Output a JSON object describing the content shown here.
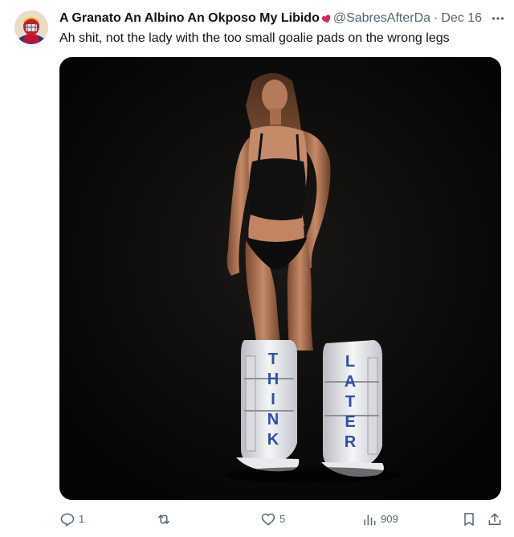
{
  "author": {
    "display_name": "A Granato An Albino An Okposo My Libido",
    "name_emoji": "heart-emoji",
    "handle": "@SabresAfterDa",
    "separator": "·",
    "date": "Dec 16",
    "avatar_icon": "avatar-goalie-helmet"
  },
  "tweet": {
    "text": "Ah shit, not the lady with the too small goalie pads on the wrong legs"
  },
  "media": {
    "pad_left_letters": "THINK",
    "pad_right_letters": "LATER",
    "background_color": "#0b0b0b",
    "lettering_color": "#2f4ea8"
  },
  "actions": {
    "reply_count": "1",
    "repost_count": "",
    "like_count": "5",
    "views_count": "909"
  },
  "colors": {
    "text_primary": "#0f1419",
    "text_secondary": "#536471"
  }
}
